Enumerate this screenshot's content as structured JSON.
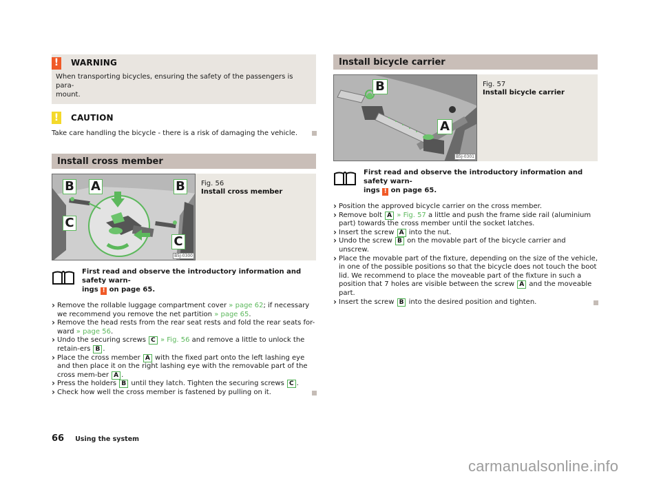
{
  "left": {
    "warning": {
      "icon": "exclamation-icon",
      "label": "WARNING",
      "text": "When transporting bicycles, ensuring the safety of the passengers is para-mount."
    },
    "caution": {
      "icon": "exclamation-icon",
      "label": "CAUTION",
      "text": "Take care handling the bicycle - there is a risk of damaging the vehicle."
    },
    "section": {
      "title": "Install cross member",
      "figure": {
        "number": "Fig. 56",
        "title": "Install cross member",
        "code": "B5J-0300",
        "callouts": [
          "B",
          "A",
          "B",
          "C",
          "C"
        ]
      },
      "intro": {
        "icon": "book-icon",
        "text_before": "First read and observe the introductory information and safety warn-ings",
        "text_after": "on page 65."
      },
      "steps": [
        {
          "parts": [
            {
              "t": "Remove the rollable luggage compartment cover "
            },
            {
              "x": "» page 62"
            },
            {
              "t": "; if necessary we recommend you remove the net partition "
            },
            {
              "x": "» page 65"
            },
            {
              "t": "."
            }
          ]
        },
        {
          "parts": [
            {
              "t": "Remove the head rests from the rear seat rests and fold the rear seats for-ward "
            },
            {
              "x": "» page 56"
            },
            {
              "t": "."
            }
          ]
        },
        {
          "parts": [
            {
              "t": "Undo the securing screws "
            },
            {
              "l": "C"
            },
            {
              "t": " "
            },
            {
              "x": "» Fig. 56"
            },
            {
              "t": " and remove a little to unlock the retain-ers "
            },
            {
              "l": "B"
            },
            {
              "t": "."
            }
          ]
        },
        {
          "parts": [
            {
              "t": "Place the cross member "
            },
            {
              "l": "A"
            },
            {
              "t": " with the fixed part onto the left lashing eye and then place it on the right lashing eye with the removable part of the cross mem-ber "
            },
            {
              "l": "A"
            },
            {
              "t": "."
            }
          ]
        },
        {
          "parts": [
            {
              "t": "Press the holders "
            },
            {
              "l": "B"
            },
            {
              "t": " until they latch. Tighten the securing screws "
            },
            {
              "l": "C"
            },
            {
              "t": "."
            }
          ]
        },
        {
          "parts": [
            {
              "t": "Check how well the cross member is fastened by pulling on it."
            }
          ]
        }
      ]
    }
  },
  "right": {
    "section": {
      "title": "Install bicycle carrier",
      "figure": {
        "number": "Fig. 57",
        "title": "Install bicycle carrier",
        "code": "B5J-0301",
        "callouts": [
          "B",
          "A"
        ]
      },
      "intro": {
        "icon": "book-icon",
        "text_before": "First read and observe the introductory information and safety warn-ings",
        "text_after": "on page 65."
      },
      "steps": [
        {
          "parts": [
            {
              "t": "Position the approved bicycle carrier on the cross member."
            }
          ]
        },
        {
          "parts": [
            {
              "t": "Remove bolt "
            },
            {
              "l": "A"
            },
            {
              "t": " "
            },
            {
              "x": "» Fig. 57"
            },
            {
              "t": " a little and push the frame side rail (aluminium part) towards the cross member until the socket latches."
            }
          ]
        },
        {
          "parts": [
            {
              "t": "Insert the screw "
            },
            {
              "l": "A"
            },
            {
              "t": " into the nut."
            }
          ]
        },
        {
          "parts": [
            {
              "t": "Undo the screw "
            },
            {
              "l": "B"
            },
            {
              "t": " on the movable part of the bicycle carrier and unscrew."
            }
          ]
        },
        {
          "parts": [
            {
              "t": "Place the movable part of the fixture, depending on the size of the vehicle, in one of the possible positions so that the bicycle does not touch the boot lid. We recommend to place the moveable part of the fixture in such a position that 7 holes are visible between the screw "
            },
            {
              "l": "A"
            },
            {
              "t": " and the moveable part."
            }
          ]
        },
        {
          "parts": [
            {
              "t": "Insert the screw "
            },
            {
              "l": "B"
            },
            {
              "t": " into the desired position and tighten."
            }
          ]
        }
      ]
    }
  },
  "footer": {
    "page_number": "66",
    "section": "Using the system"
  },
  "watermark": "carmanualsonline.info",
  "colors": {
    "warning": "#f05a28",
    "caution": "#f4d92a",
    "accent_green": "#5cb85c",
    "section_header": "#c9beb8",
    "panel": "#e9e5e0"
  }
}
